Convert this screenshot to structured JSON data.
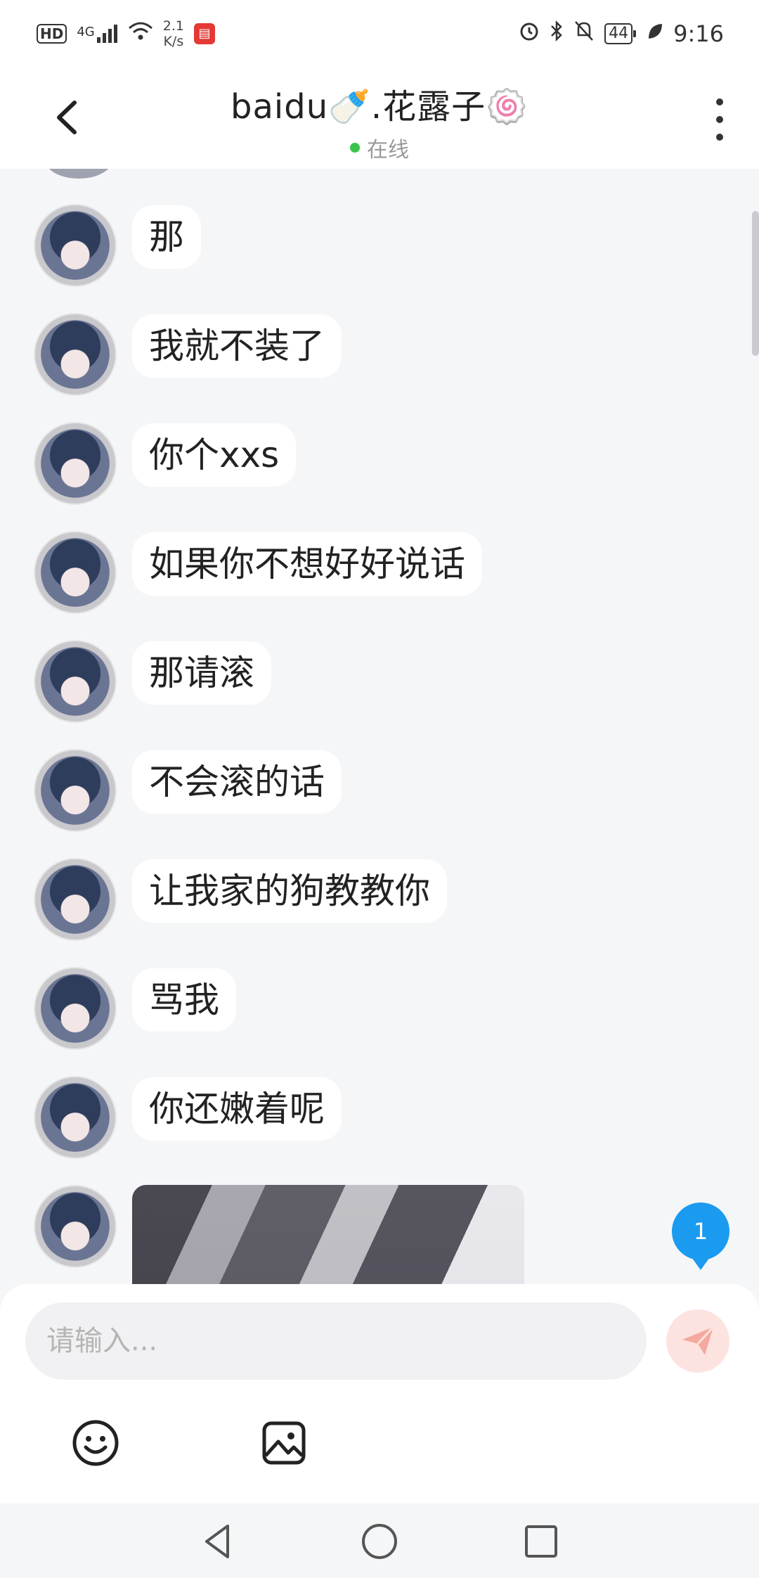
{
  "status_bar": {
    "hd": "HD",
    "network": "4G",
    "speed_value": "2.1",
    "speed_unit": "K/s",
    "battery": "44",
    "time": "9:16"
  },
  "header": {
    "title": "baidu🍼.花露子🍥",
    "status": "在线"
  },
  "messages": [
    {
      "text": "那"
    },
    {
      "text": "我就不装了"
    },
    {
      "text": "你个xxs"
    },
    {
      "text": "如果你不想好好说话"
    },
    {
      "text": "那请滚"
    },
    {
      "text": "不会滚的话"
    },
    {
      "text": "让我家的狗教教你"
    },
    {
      "text": "骂我"
    },
    {
      "text": "你还嫩着呢"
    }
  ],
  "new_message_badge": "1",
  "composer": {
    "placeholder": "请输入..."
  },
  "colors": {
    "online": "#3bc44b",
    "badge": "#1a9bf0",
    "send": "#fde3e0"
  }
}
